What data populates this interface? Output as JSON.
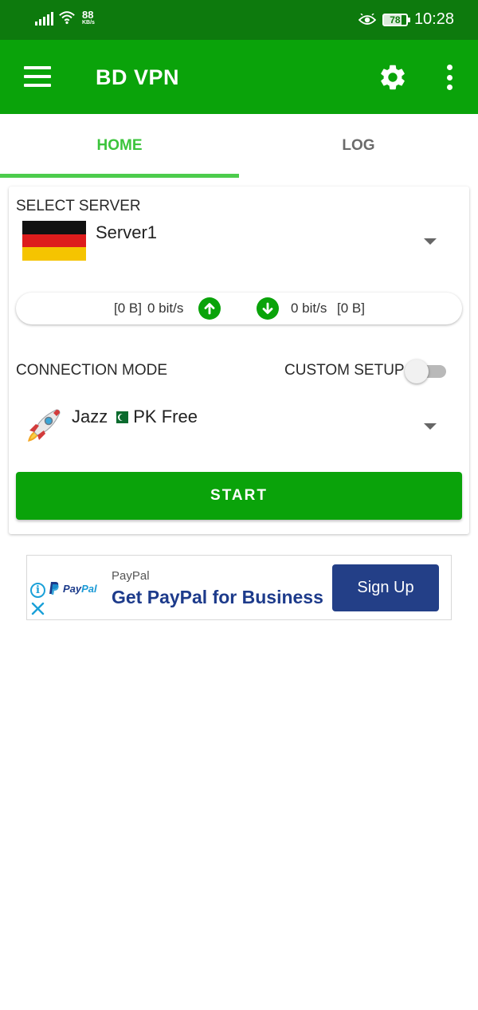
{
  "status_bar": {
    "net_speed_value": "88",
    "net_speed_unit": "KB/s",
    "battery_level": "78",
    "battery_fraction": 0.78,
    "time": "10:28"
  },
  "app_bar": {
    "title": "BD VPN",
    "icons": [
      "menu-icon",
      "gear-icon",
      "more-vert-icon"
    ]
  },
  "tabs": [
    {
      "label": "HOME",
      "active": true
    },
    {
      "label": "LOG",
      "active": false
    }
  ],
  "server": {
    "section_label": "SELECT SERVER",
    "selected": "Server1",
    "flag": "germany-flag-icon"
  },
  "traffic": {
    "upload_total": "[0 B]",
    "upload_rate": "0 bit/s",
    "download_rate": "0 bit/s",
    "download_total": "[0 B]"
  },
  "connection": {
    "section_label": "CONNECTION MODE",
    "custom_setup_label": "CUSTOM SETUP",
    "custom_setup_enabled": false,
    "mode_name": "Jazz",
    "mode_suffix": "PK Free",
    "mode_icon": "rocket-icon"
  },
  "start_label": "START",
  "ad": {
    "brand": "PayPal",
    "logo_text_a": "Pay",
    "logo_text_b": "Pal",
    "headline": "Get PayPal for Business",
    "cta": "Sign Up"
  },
  "colors": {
    "status_bar": "#0d7a0d",
    "app_bar": "#0aa30a",
    "tab_active": "#3cc43c",
    "ad_navy": "#233f87"
  }
}
